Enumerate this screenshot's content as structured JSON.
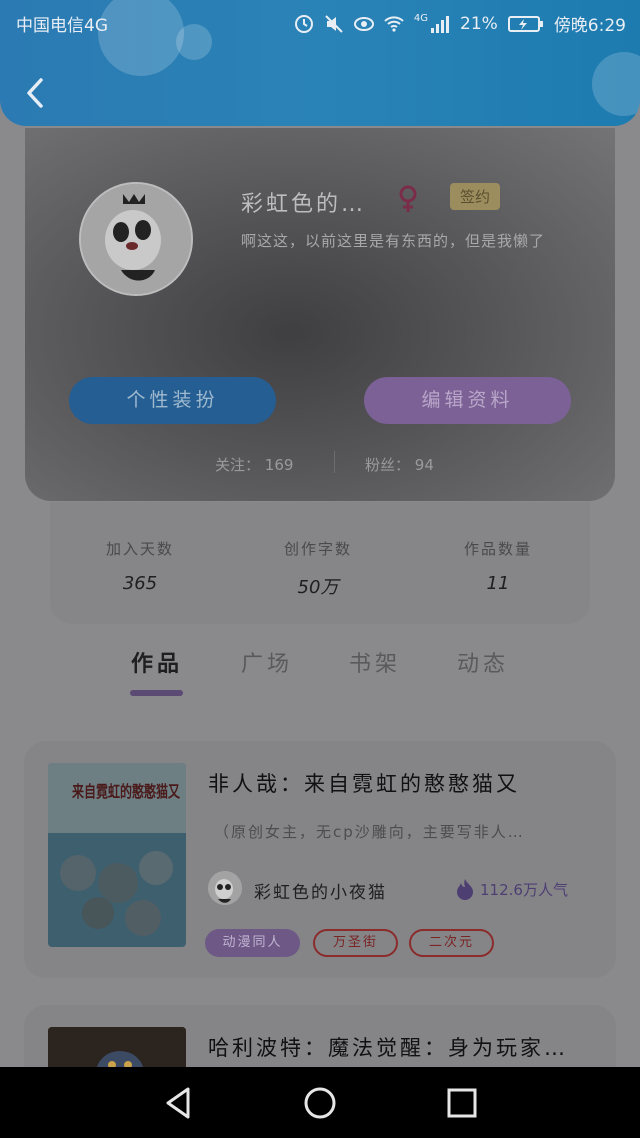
{
  "status_bar": {
    "carrier": "中国电信4G",
    "network": "4G",
    "battery": "21%",
    "time": "傍晚6:29"
  },
  "profile": {
    "nickname": "彩虹色的…",
    "signed_badge": "签约",
    "bio": "啊这这，以前这里是有东西的，但是我懒了",
    "dress_button": "个性装扮",
    "edit_button": "编辑资料",
    "following_label": "关注：",
    "following_count": "169",
    "fans_label": "粉丝：",
    "fans_count": "94"
  },
  "stats": [
    {
      "label": "加入天数",
      "value": "365"
    },
    {
      "label": "创作字数",
      "value": "50万"
    },
    {
      "label": "作品数量",
      "value": "11"
    }
  ],
  "tabs": [
    "作品",
    "广场",
    "书架",
    "动态"
  ],
  "active_tab": "作品",
  "books": [
    {
      "title": "非人哉：来自霓虹的憨憨猫又",
      "description": "（原创女主，无cp沙雕向，主要写非人…",
      "author": "彩虹色的小夜猫",
      "popularity": "112.6万人气",
      "tags": [
        "动漫同人",
        "万圣街",
        "二次元"
      ],
      "cover_text": "来自霓虹的憨憨猫又"
    },
    {
      "title": "哈利波特：魔法觉醒：身为玩家…"
    }
  ],
  "colors": {
    "header": "#2a83b6",
    "accent_purple": "#7c6196",
    "accent_blue": "#245e92",
    "tag_red": "#8b2b2b"
  }
}
